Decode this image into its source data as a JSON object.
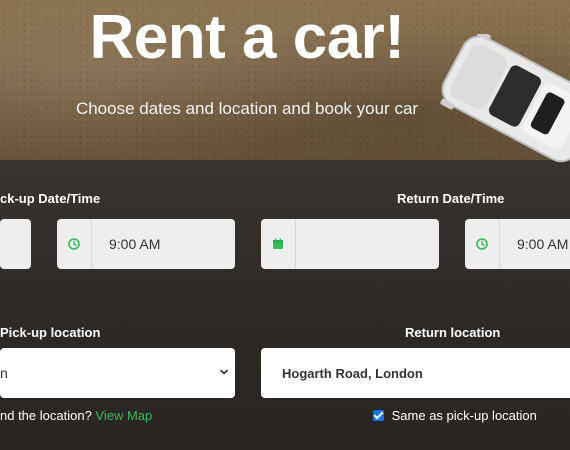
{
  "hero": {
    "title": "Rent a car!",
    "subtitle": "Choose dates and location and book your car"
  },
  "pickup": {
    "datetime_label": "ck-up Date/Time",
    "time_value": "9:00 AM",
    "location_label": "Pick-up location",
    "location_value": "n"
  },
  "return": {
    "datetime_label": "Return Date/Time",
    "time_value": "9:00 AM",
    "location_label": "Return location",
    "location_value": "Hogarth Road, London"
  },
  "footer": {
    "find_location_text": "nd the location?",
    "view_map_link": "View Map",
    "same_as_pickup_text": "Same as pick-up location",
    "same_as_pickup_checked": true
  },
  "icons": {
    "clock": "clock-icon",
    "calendar": "calendar-icon",
    "chevron": "chevron-down-icon"
  },
  "colors": {
    "accent": "#3cba59",
    "checkbox": "#1a73e8"
  }
}
